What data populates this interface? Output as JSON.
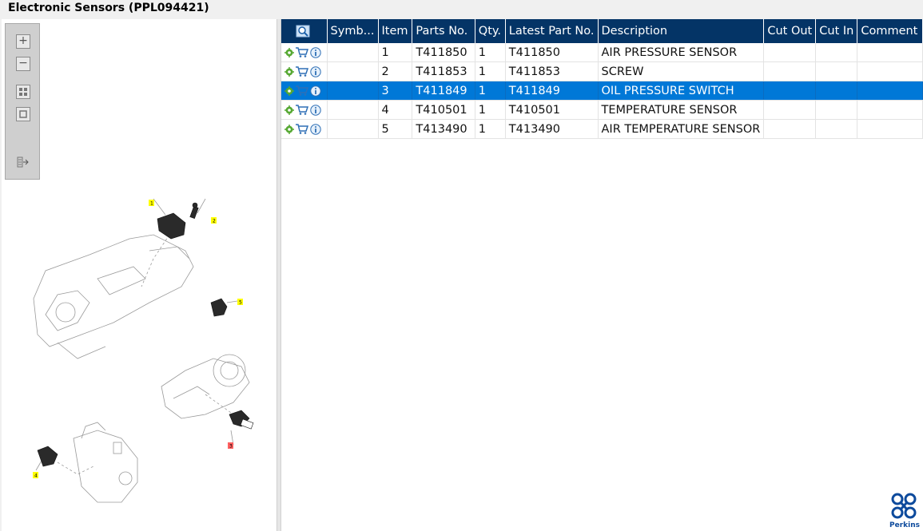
{
  "window": {
    "title": "Electronic Sensors (PPL094421)"
  },
  "toolbar": {
    "icons": [
      "zoom-in-icon",
      "zoom-out-icon",
      "fit-all-icon",
      "fit-window-icon",
      "export-icon"
    ]
  },
  "drawing": {
    "callouts": [
      "1",
      "2",
      "5",
      "3",
      "4"
    ]
  },
  "table": {
    "columns": [
      "Symb...",
      "Item",
      "Parts No.",
      "Qty.",
      "Latest Part No.",
      "Description",
      "Cut Out",
      "Cut In",
      "Comment"
    ],
    "rows": [
      {
        "item": "1",
        "part_no": "T411850",
        "qty": "1",
        "latest_part_no": "T411850",
        "description": "AIR PRESSURE SENSOR",
        "cut_out": "",
        "cut_in": "",
        "comment": ""
      },
      {
        "item": "2",
        "part_no": "T411853",
        "qty": "1",
        "latest_part_no": "T411853",
        "description": "SCREW",
        "cut_out": "",
        "cut_in": "",
        "comment": ""
      },
      {
        "item": "3",
        "part_no": "T411849",
        "qty": "1",
        "latest_part_no": "T411849",
        "description": "OIL PRESSURE SWITCH",
        "cut_out": "",
        "cut_in": "",
        "comment": "",
        "selected": true
      },
      {
        "item": "4",
        "part_no": "T410501",
        "qty": "1",
        "latest_part_no": "T410501",
        "description": "TEMPERATURE SENSOR",
        "cut_out": "",
        "cut_in": "",
        "comment": ""
      },
      {
        "item": "5",
        "part_no": "T413490",
        "qty": "1",
        "latest_part_no": "T413490",
        "description": "AIR TEMPERATURE SENSOR",
        "cut_out": "",
        "cut_in": "",
        "comment": ""
      }
    ],
    "row_icons": [
      "settings-gear-icon",
      "cart-icon",
      "info-icon"
    ],
    "selected_color": "#0078d7",
    "header_color": "#043466"
  },
  "branding": {
    "logo_text": "Perkins"
  }
}
